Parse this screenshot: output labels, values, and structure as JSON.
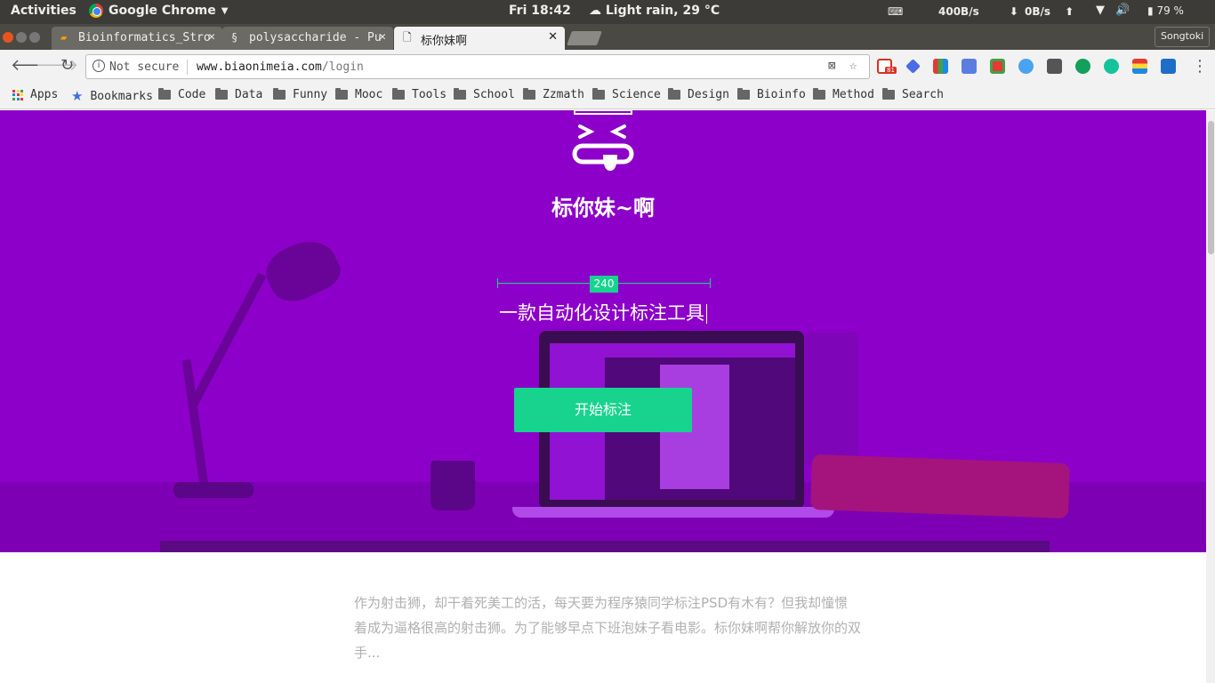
{
  "system": {
    "activities": "Activities",
    "app_name": "Google Chrome",
    "clock": "Fri 18:42",
    "weather": "Light rain, 29 °C",
    "net_down": "400B/s",
    "net_up": "0B/s",
    "battery": "79 %"
  },
  "tabs": [
    {
      "label": "Bioinformatics_Stro",
      "icon": "document-icon"
    },
    {
      "label": "polysaccharide - Pu",
      "icon": "pubmed-icon"
    },
    {
      "label": "标你妹啊",
      "icon": "page-icon"
    }
  ],
  "profile": "Songtoki",
  "omnibox": {
    "security": "Not secure",
    "domain": "www.biaonimeia.com",
    "path": "/login"
  },
  "extensions": {
    "gmail_badge": "81"
  },
  "bookmarks": {
    "apps": "Apps",
    "bookmarks": "Bookmarks",
    "folders": [
      "Code",
      "Data",
      "Funny",
      "Mooc",
      "Tools",
      "School",
      "Zzmath",
      "Science",
      "Design",
      "Bioinfo",
      "Method",
      "Search"
    ]
  },
  "hero": {
    "brand": "标你妹~啊",
    "measure_value": "240",
    "tagline": "一款自动化设计标注工具",
    "cta": "开始标注"
  },
  "description": "作为射击狮，却干着死美工的活，每天要为程序猿同学标注PSD有木有？但我却憧憬着成为逼格很高的射击狮。为了能够早点下班泡妹子看电影。标你妹啊帮你解放你的双手...",
  "colors": {
    "hero_bg": "#8d00c9",
    "accent": "#17d38e"
  }
}
